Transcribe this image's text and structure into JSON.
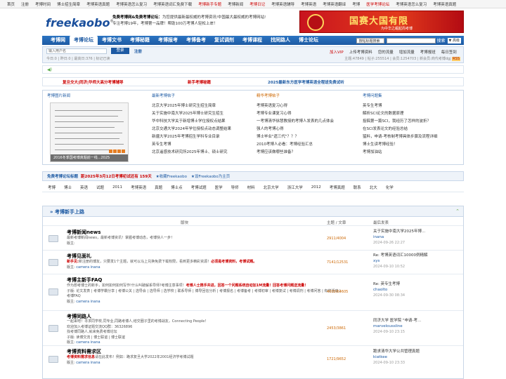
{
  "topbar": {
    "links": [
      "首页",
      "注册",
      "考博时间",
      "博士招生简章",
      "考博英语真题",
      "考博英语怎么复习",
      "考博英语词汇免费下载",
      "考博新手专题",
      "考博新闻",
      "考博日记",
      "考博英语辅导",
      "考博英语",
      "考博英语翻译",
      "考博",
      "医学考博论坛",
      "考博英语怎么复习",
      "考博英语真题"
    ]
  },
  "header": {
    "logo": "freekaobo",
    "line1_bold": "免费考博网&免费考博论坛：",
    "line1": "为您提供最新最权威的考博资讯!中国最大最权威的考博网站!",
    "line2": "专注考博19年，考博第一品牌！帮助100万考博人轻松上岸！",
    "banner_title": "国赛大国有限",
    "banner_sub": "为中华之崛起而考博"
  },
  "nav": {
    "items": [
      "考博网",
      "考博论坛",
      "考博文书",
      "考博秘籍",
      "考博报考",
      "考博备考",
      "复试调剂",
      "考博课程",
      "找同路人",
      "博士论坛"
    ],
    "active": 1,
    "select": "按帖标题搜索",
    "search": "搜索",
    "advanced": "高级"
  },
  "user": {
    "placeholder": "输入用户名",
    "login": "登录",
    "register": "注册",
    "stats": "今日:0 | 昨日:0 | 最高日:376 | 标记已读",
    "links": [
      "加入VIP",
      "上传考博资料",
      "您的流量",
      "增加流量",
      "考博报班",
      "每日签到"
    ],
    "stats2": "主题:47849 | 帖子:255514 | 会员:1254703 | 新会员:商代考博dgj"
  },
  "headlines": {
    "h1": "复旦交大|同济|华师大高分考博辅导",
    "h2": "新手考博秘籍",
    "h3": "2025最新东方医学考博英语全程班免费试听"
  },
  "table": {
    "col1": "考博图片新闻",
    "col2": "最新考博帖子",
    "col3": "精华考博帖子",
    "col4": "考博问题集",
    "photo_caption": "2016冬季国考博真题前一线...2025",
    "list2": [
      "北京大学2025年博士研究生招生简章",
      "关于实施中南大学2025年博士研究生招生",
      "华中科技大学关于新增博士学位授权点结果",
      "北京交通大学2024年学位授权点动态调整结果",
      "新疆大学2025年考博招生学科专业目录",
      "英专生考博",
      "北京遥感技术研究所2025年博士、硕士研究"
    ],
    "list3": [
      "考博英语复习心得",
      "考博专业课复习心得",
      "一考博清华徐慧教授的考博人发表的几点体会",
      "强人的考博心得",
      "博士毕业\"遗三代\"？？？",
      "2010考博人必看：考博经验汇总",
      "考博应该做哪些准备？"
    ],
    "list4": [
      "英专生考博",
      "解析SCI论文的数据原理",
      "投稿第一篇SCI，我经历了怎样的波折？",
      "在SCI发表论文的经验总结",
      "猛料，申请-考核制考博具体步骤及流程详细",
      "博士生读考博经验！",
      "考博加油站"
    ]
  },
  "notice": {
    "title": "免费考博论坛标题",
    "date_text": "距2025年3月12日考博初试还有 159天",
    "bookmark": "收藏Freekaobo",
    "homepage": "设Freekaobo为主页"
  },
  "tags": [
    "考博",
    "博士",
    "英语",
    "试题",
    "2011",
    "考博英语",
    "真题",
    "博士点",
    "考博试题",
    "医学",
    "导师",
    "材料",
    "北京大学",
    "浙江大学",
    "2012",
    "考博真题",
    "联系",
    "北大",
    "化学"
  ],
  "forum": {
    "title": "考博新手上路",
    "cols": {
      "board": "版块",
      "topics": "主题 / 文章",
      "last": "最后发表"
    },
    "rows": [
      {
        "title": "考博新闻news",
        "desc": "最新考博新闻news，最新考博资讯！掌握考博动态，考博快人一步！",
        "mod": "版主:",
        "counts": "2911/4004",
        "last_title": "关于实施中南大学2025年博...",
        "last_user": "inana",
        "last_time": "2024-09-26 22:27"
      },
      {
        "title": "考博见面礼",
        "desc_red": "新手见:",
        "desc": "新注册的博友，只要发1个主题，就可以马上兑换免费下载权限，看到更多精彩资源！",
        "desc_red2": "必须是考博资料，考博试题。",
        "mod": "版主:",
        "mod_user": "camera inana",
        "counts": "7141/12531",
        "last_title": "Re: 考博英语词汇10000例精解",
        "last_user": "xys",
        "last_time": "2024-09-10 10:52"
      },
      {
        "title": "考博主新手FAQ",
        "desc": "作为想考博士的新手，如何如何如何写作!什么叫破解系导师?考博注意事项！",
        "desc_red2": "考博人士携手共进，回答一个问题系统自动加1M流量！回答考博问题送流量！",
        "sub": "子版: 论文发表 | 考博学霸分享 | 考博公关 | 选导会 | 选导师 | 选学校 | 联系导师 | 博导回信分析 | 考博报名 | 考博备考 | 考博初审 | 考博复试 | 考博调剂 | 考博问答 | 有奖活动 | 考博FAQ",
        "mod": "版主:",
        "mod_user": "camera inana",
        "counts": "4000/64605",
        "last_title": "Re: 英专生考博",
        "last_user": "chaolto",
        "last_time": "2024-09-30 08:34"
      },
      {
        "title": "考博同路人",
        "desc": "一起来吧！寻求同学校,同专业,同路考博人,结交圈子里的考博战友，Connecting People！",
        "desc2": "欢迎加入考博证题交流QQ群：36326896",
        "desc3": "找考博同路人,就来免费考博论坛",
        "sub": "子版: 读博交流 | 博士联谊 | 博士联谊",
        "mod": "版主:",
        "mod_user": "camera inana",
        "counts": "2453/3861",
        "last_title": "同济大学 医学院 \"申请-考...",
        "last_user": "marveloussline",
        "last_time": "2024-09-10 23:15"
      },
      {
        "title": "考博资料需求区",
        "desc_red": "考博资料需求信息",
        "desc": "请在此发布！例如：跪求复旦大学2022年2001经济学考博试题",
        "mod": "版主:",
        "mod_user": "camera inana",
        "counts": "1721/9652",
        "last_title": "跪求清华大学公共管理真题",
        "last_user": "kiatkee",
        "last_time": "2024-09-10 23:33"
      }
    ]
  }
}
